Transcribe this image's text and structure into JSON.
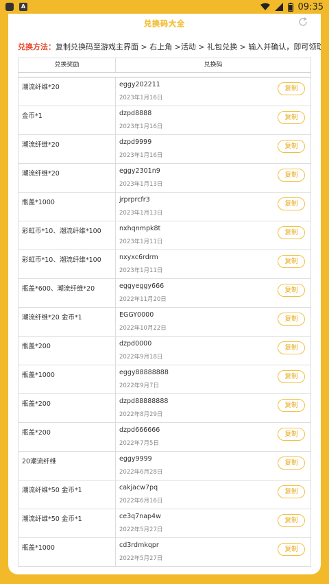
{
  "status_bar": {
    "time": "09:35",
    "app_badge": "A"
  },
  "header": {
    "title": "兑换码大全"
  },
  "method": {
    "label": "兑换方法：",
    "text": "复制兑换码至游戏主界面 > 右上角 >活动 > 礼包兑换 > 输入并确认，即可领取奖励。"
  },
  "table": {
    "col_reward": "兑换奖励",
    "col_code": "兑换码",
    "copy_label": "复制",
    "rows": [
      {
        "reward": "潮流纤维*20",
        "code": "eggy202211",
        "date": "2023年1月16日"
      },
      {
        "reward": "金币*1",
        "code": "dzpd8888",
        "date": "2023年1月16日"
      },
      {
        "reward": "潮流纤维*20",
        "code": "dzpd9999",
        "date": "2023年1月16日"
      },
      {
        "reward": "潮流纤维*20",
        "code": "eggy2301n9",
        "date": "2023年1月13日"
      },
      {
        "reward": "瓶盖*1000",
        "code": "jrprprcfr3",
        "date": "2023年1月13日"
      },
      {
        "reward": "彩虹币*10、潮流纤维*100",
        "code": "nxhqnmpk8t",
        "date": "2023年1月11日"
      },
      {
        "reward": "彩虹币*10、潮流纤维*100",
        "code": "nxyxc6rdrm",
        "date": "2023年1月11日"
      },
      {
        "reward": "瓶盖*600、潮流纤维*20",
        "code": "eggyeggy666",
        "date": "2022年11月20日"
      },
      {
        "reward": "潮流纤维*20 金币*1",
        "code": "EGGY0000",
        "date": "2022年10月22日"
      },
      {
        "reward": "瓶盖*200",
        "code": "dzpd0000",
        "date": "2022年9月18日"
      },
      {
        "reward": "瓶盖*1000",
        "code": "eggy88888888",
        "date": "2022年9月7日"
      },
      {
        "reward": "瓶盖*200",
        "code": "dzpd88888888",
        "date": "2022年8月29日"
      },
      {
        "reward": "瓶盖*200",
        "code": "dzpd666666",
        "date": "2022年7月5日"
      },
      {
        "reward": "20潮流纤维",
        "code": "eggy9999",
        "date": "2022年6月28日"
      },
      {
        "reward": "潮流纤维*50 金币*1",
        "code": "cakjacw7pq",
        "date": "2022年6月16日"
      },
      {
        "reward": "潮流纤维*50 金币*1",
        "code": "ce3q7nap4w",
        "date": "2022年5月27日"
      },
      {
        "reward": "瓶盖*1000",
        "code": "cd3rdmkqpr",
        "date": "2022年5月27日"
      }
    ]
  }
}
